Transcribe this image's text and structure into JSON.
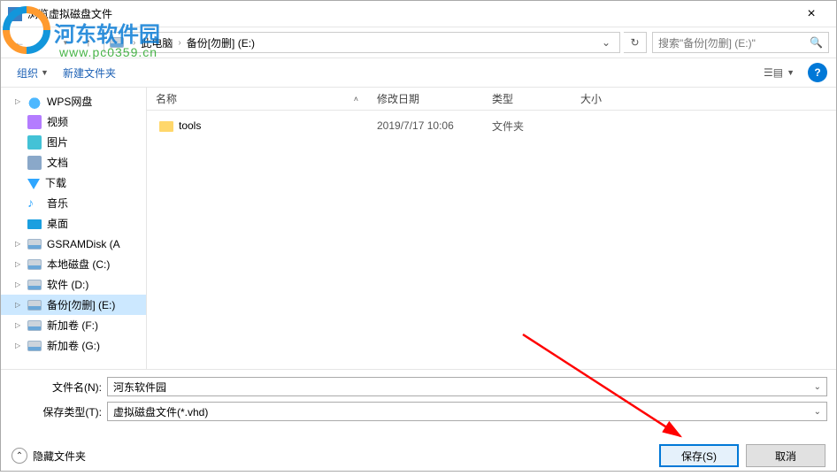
{
  "window": {
    "title": "浏览虚拟磁盘文件"
  },
  "watermark": {
    "name": "河东软件园",
    "url": "www.pc0359.cn"
  },
  "breadcrumb": {
    "pc": "此电脑",
    "drive": "备份[勿删] (E:)"
  },
  "search": {
    "placeholder": "搜索\"备份[勿删] (E:)\""
  },
  "toolbar": {
    "organize": "组织",
    "newfolder": "新建文件夹"
  },
  "columns": {
    "name": "名称",
    "date": "修改日期",
    "type": "类型",
    "size": "大小"
  },
  "sidebar": {
    "items": [
      {
        "label": "WPS网盘",
        "icon": "ico-cloud",
        "expand": true
      },
      {
        "label": "视频",
        "icon": "ico-vid"
      },
      {
        "label": "图片",
        "icon": "ico-pic"
      },
      {
        "label": "文档",
        "icon": "ico-doc"
      },
      {
        "label": "下载",
        "icon": "ico-dl"
      },
      {
        "label": "音乐",
        "icon": "ico-music",
        "glyph": "♪"
      },
      {
        "label": "桌面",
        "icon": "ico-desk"
      },
      {
        "label": "GSRAMDisk (A",
        "icon": "ico-drive",
        "expand": true
      },
      {
        "label": "本地磁盘 (C:)",
        "icon": "ico-drive",
        "expand": true
      },
      {
        "label": "软件 (D:)",
        "icon": "ico-drive",
        "expand": true
      },
      {
        "label": "备份[勿删] (E:)",
        "icon": "ico-drive",
        "expand": true,
        "selected": true
      },
      {
        "label": "新加卷 (F:)",
        "icon": "ico-drive",
        "expand": true
      },
      {
        "label": "新加卷 (G:)",
        "icon": "ico-drive",
        "expand": true
      }
    ]
  },
  "files": [
    {
      "name": "tools",
      "date": "2019/7/17 10:06",
      "type": "文件夹"
    }
  ],
  "form": {
    "filename_label": "文件名(N):",
    "filename_value": "河东软件园",
    "savetype_label": "保存类型(T):",
    "savetype_value": "虚拟磁盘文件(*.vhd)"
  },
  "footer": {
    "hide_folders": "隐藏文件夹",
    "save": "保存(S)",
    "cancel": "取消"
  }
}
